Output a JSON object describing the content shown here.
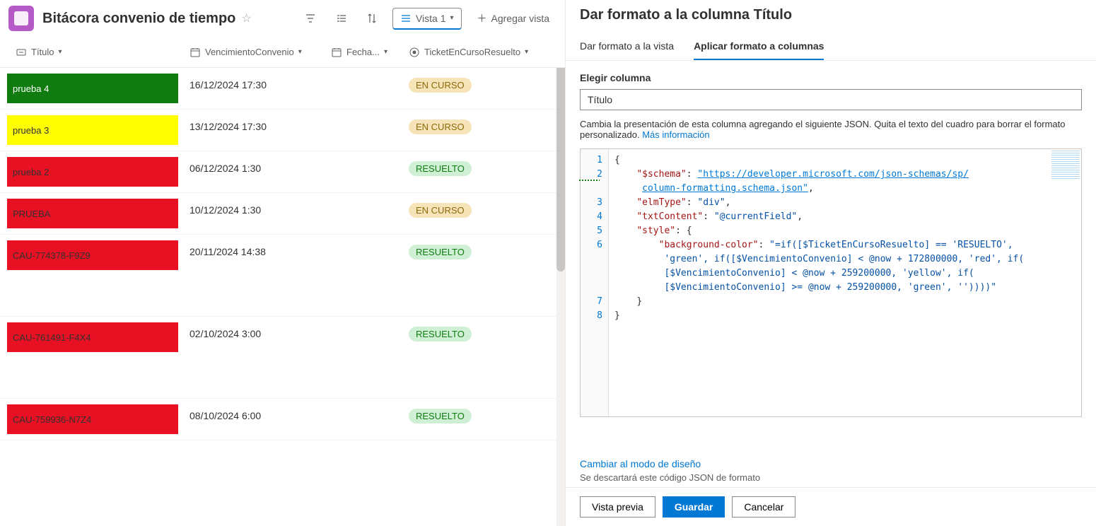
{
  "header": {
    "title": "Bitácora convenio de tiempo",
    "view_label": "Vista 1",
    "add_view": "Agregar vista"
  },
  "columns": {
    "titulo": "Título",
    "vencimiento": "VencimientoConvenio",
    "fecha": "Fecha...",
    "ticket": "TicketEnCursoResuelto"
  },
  "rows": [
    {
      "title": "prueba 4",
      "color": "green",
      "venc": "16/12/2024 17:30",
      "status": "EN CURSO",
      "status_kind": "curso",
      "tall": false
    },
    {
      "title": "prueba 3",
      "color": "yellow",
      "venc": "13/12/2024 17:30",
      "status": "EN CURSO",
      "status_kind": "curso",
      "tall": false
    },
    {
      "title": "prueba 2",
      "color": "red",
      "venc": "06/12/2024 1:30",
      "status": "RESUELTO",
      "status_kind": "resuelto",
      "tall": false
    },
    {
      "title": "PRUEBA",
      "color": "red",
      "venc": "10/12/2024 1:30",
      "status": "EN CURSO",
      "status_kind": "curso",
      "tall": false
    },
    {
      "title": "CAU-774378-F9Z9",
      "color": "red",
      "venc": "20/11/2024 14:38",
      "status": "RESUELTO",
      "status_kind": "resuelto",
      "tall": true
    },
    {
      "title": "CAU-761491-F4X4",
      "color": "red",
      "venc": "02/10/2024 3:00",
      "status": "RESUELTO",
      "status_kind": "resuelto",
      "tall": true
    },
    {
      "title": "CAU-759936-N7Z4",
      "color": "red",
      "venc": "08/10/2024 6:00",
      "status": "RESUELTO",
      "status_kind": "resuelto",
      "tall": false
    }
  ],
  "panel": {
    "title": "Dar formato a la columna Título",
    "tab_view": "Dar formato a la vista",
    "tab_col": "Aplicar formato a columnas",
    "choose_col": "Elegir columna",
    "selected_col": "Título",
    "help": "Cambia la presentación de esta columna agregando el siguiente JSON. Quita el texto del cuadro para borrar el formato personalizado.",
    "more_info": "Más información",
    "design_mode": "Cambiar al modo de diseño",
    "discard_note": "Se descartará este código JSON de formato",
    "preview": "Vista previa",
    "save": "Guardar",
    "cancel": "Cancelar"
  },
  "json_editor": {
    "schema_key": "\"$schema\"",
    "schema_val_1": "\"https://developer.microsoft.com/json-schemas/sp/",
    "schema_val_2": "column-formatting.schema.json\"",
    "elm_key": "\"elmType\"",
    "elm_val": "\"div\"",
    "txt_key": "\"txtContent\"",
    "txt_val": "\"@currentField\"",
    "style_key": "\"style\"",
    "bg_key": "\"background-color\"",
    "bg_val_1": "\"=if([$TicketEnCursoResuelto] == 'RESUELTO',",
    "bg_val_2": "'green', if([$VencimientoConvenio] < @now + 172800000, 'red', if(",
    "bg_val_3": "[$VencimientoConvenio] < @now + 259200000, 'yellow', if(",
    "bg_val_4": "[$VencimientoConvenio] >= @now + 259200000, 'green', ''))))\""
  }
}
